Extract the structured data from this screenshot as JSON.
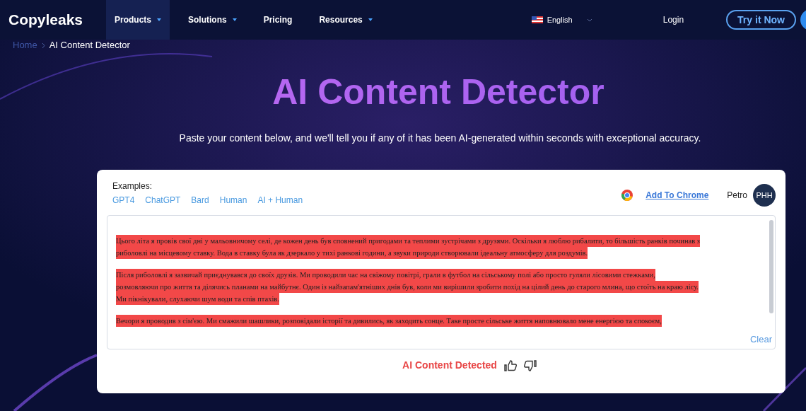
{
  "header": {
    "logo": "Copyleaks",
    "nav": [
      {
        "label": "Products",
        "selected": true,
        "dropdown": true
      },
      {
        "label": "Solutions",
        "selected": false,
        "dropdown": true
      },
      {
        "label": "Pricing",
        "selected": false,
        "dropdown": false
      },
      {
        "label": "Resources",
        "selected": false,
        "dropdown": true
      }
    ],
    "language": "English",
    "login": "Login",
    "cta": "Try it Now"
  },
  "breadcrumb": [
    {
      "label": "Home",
      "current": false
    },
    {
      "label": "AI Content Detector",
      "current": true
    }
  ],
  "title": "AI Content Detector",
  "subtitle": "Paste your content below, and we'll tell you if any of it has been AI-generated within seconds with exceptional accuracy.",
  "card": {
    "examples_label": "Examples:",
    "examples": [
      "GPT4",
      "ChatGPT",
      "Bard",
      "Human",
      "AI + Human"
    ],
    "add_to_chrome": "Add To Chrome",
    "user_name": "Petro",
    "avatar": "PHH",
    "paragraphs": [
      {
        "lines": [
          {
            "text": "Цього літа я провів свої дні у мальовничому селі, де кожен день був сповнений пригодами та теплими зустрічами з друзями. Оскільки я люблю рибалити, то більшість ранків починав з",
            "ai": true
          },
          {
            "text": "риболовлі на місцевому ставку. Вода в ставку була як дзеркало у тихі ранкові години, а звуки природи створювали ідеальну атмосферу для роздумів.",
            "ai": true
          }
        ]
      },
      {
        "lines": [
          {
            "text": "Після риболовлі я зазвичай приєднувався до своїх друзів. Ми проводили час на свіжому повітрі, грали в футбол на сільському полі або просто гуляли лісовими стежками,",
            "ai": true
          },
          {
            "text": "розмовляючи про життя та ділячись планами на майбутнє. Один із найзапам'ятніших днів був, коли ми вирішили зробити похід на цілий день до старого млина, що стоїть на краю лісу.",
            "ai": true
          },
          {
            "text": "Ми пікнікували, слухаючи шум води та спів птахів.",
            "ai": true
          }
        ]
      },
      {
        "lines": [
          {
            "text": "Вечори я проводив з сім'єю. Ми смажили шашлики, розповідали історії та дивились, як заходить сонце. Таке просте сільське життя наповнювало мене енергією та спокоєм,",
            "ai": true
          }
        ]
      }
    ],
    "clear": "Clear",
    "result": "AI Content Detected"
  }
}
